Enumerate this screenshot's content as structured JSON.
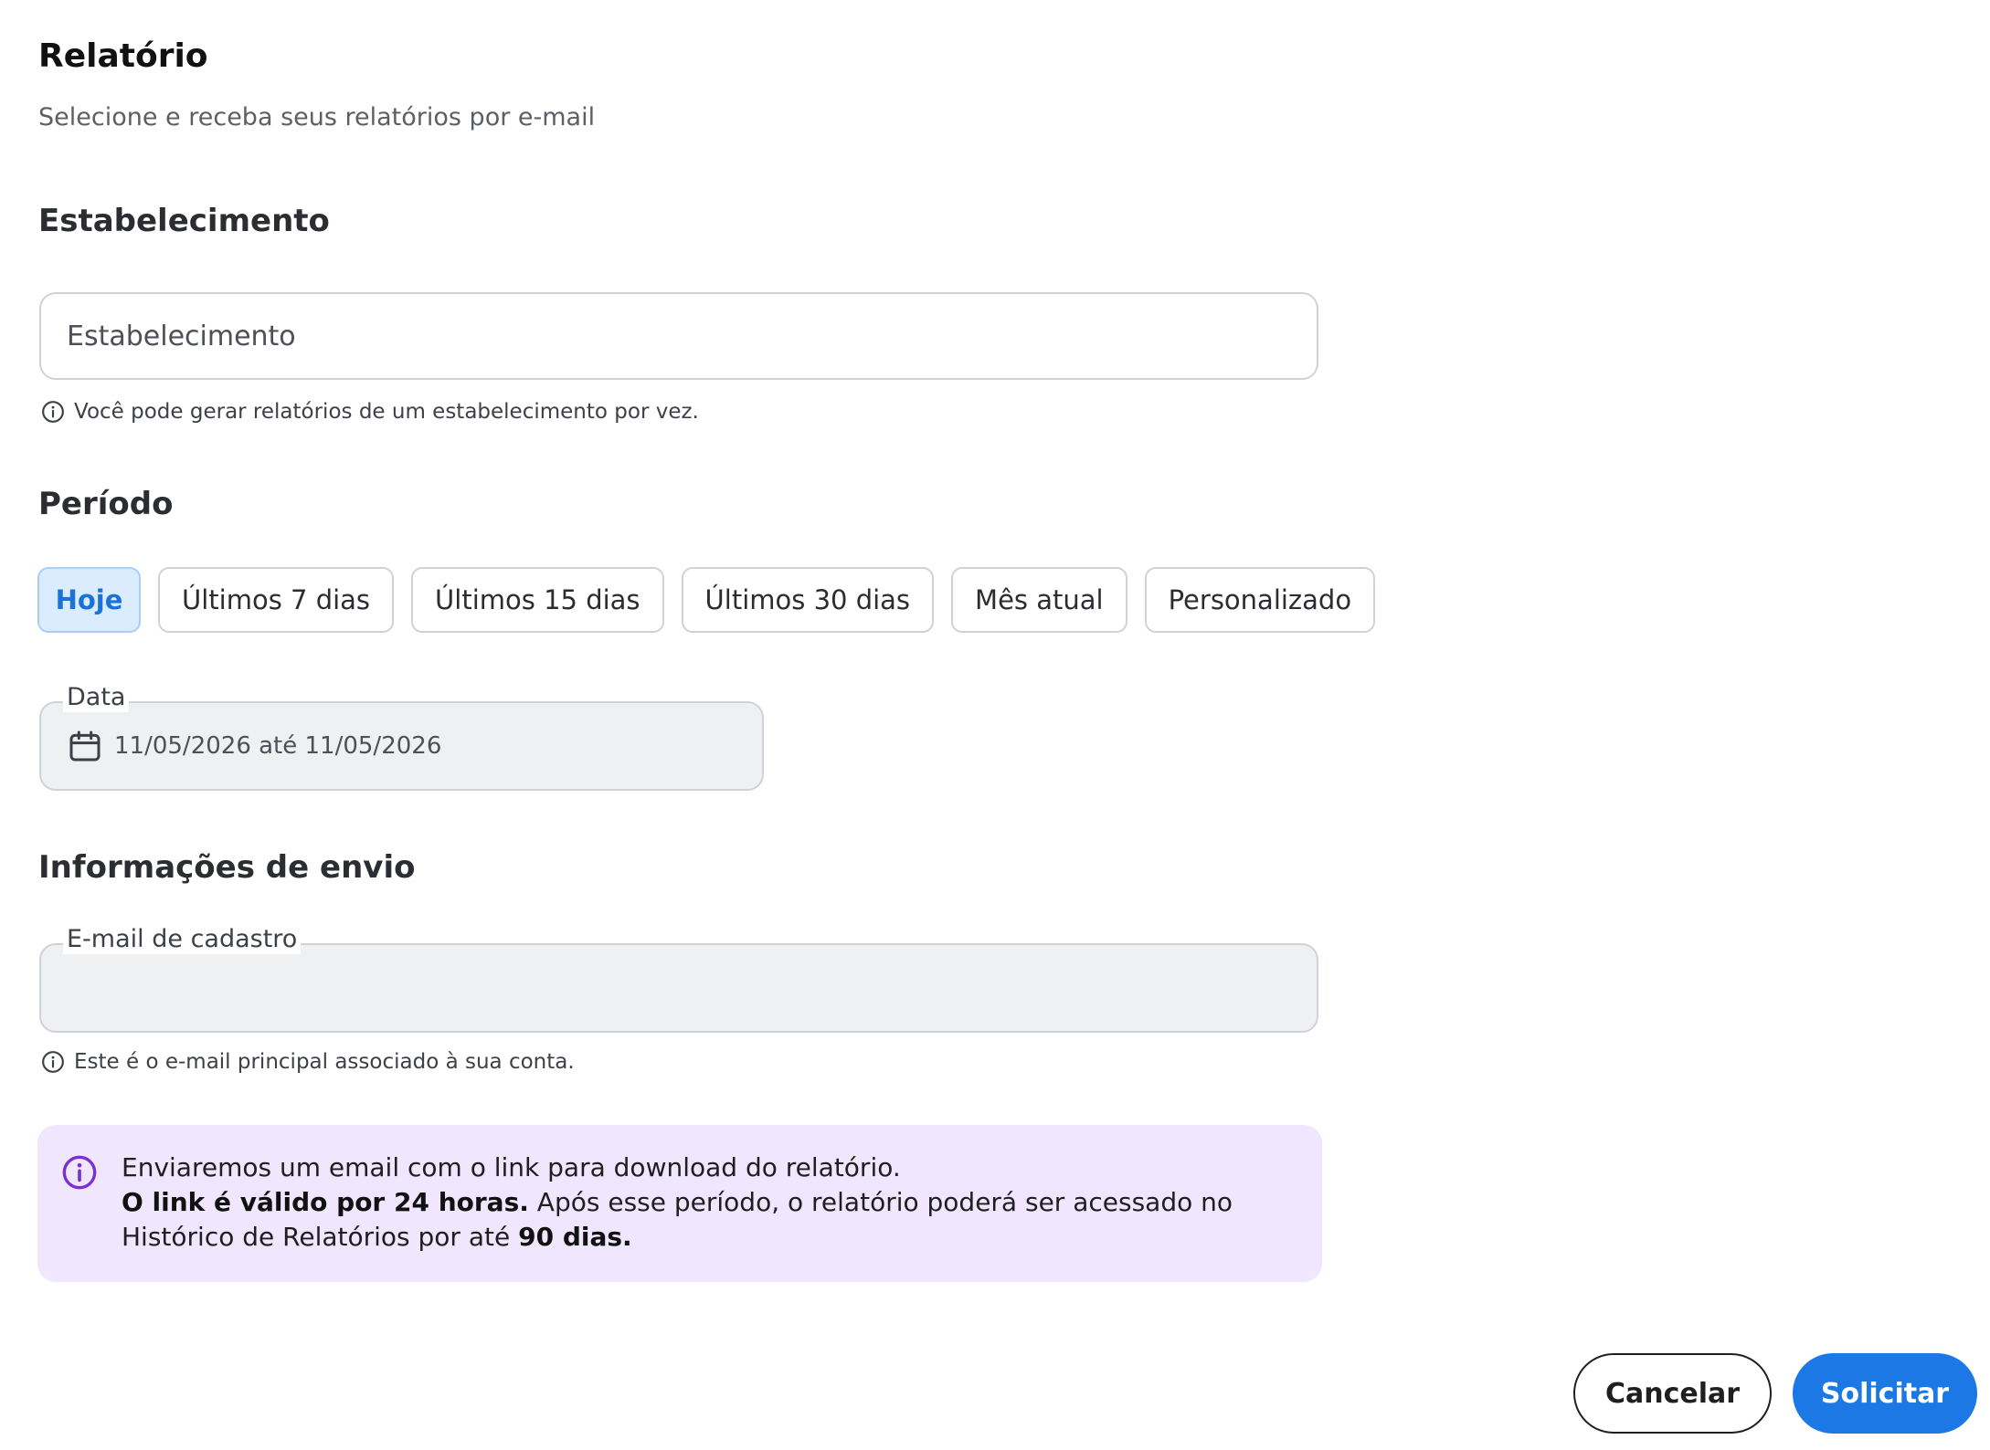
{
  "header": {
    "title": "Relatório",
    "subtitle": "Selecione e receba seus relatórios por e-mail"
  },
  "establishment": {
    "section_title": "Estabelecimento",
    "placeholder": "Estabelecimento",
    "hint": "Você pode gerar relatórios de um estabelecimento por vez."
  },
  "period": {
    "section_title": "Período",
    "options": [
      {
        "label": "Hoje",
        "selected": true
      },
      {
        "label": "Últimos 7 dias",
        "selected": false
      },
      {
        "label": "Últimos 15 dias",
        "selected": false
      },
      {
        "label": "Últimos 30 dias",
        "selected": false
      },
      {
        "label": "Mês atual",
        "selected": false
      },
      {
        "label": "Personalizado",
        "selected": false
      }
    ],
    "date_label": "Data",
    "date_value": "11/05/2026 até 11/05/2026"
  },
  "delivery": {
    "section_title": "Informações de envio",
    "email_label": "E-mail de cadastro",
    "email_value": "",
    "hint": "Este é o e-mail principal associado à sua conta."
  },
  "notice": {
    "line1": "Enviaremos um email com o link para download do relatório.",
    "bold1": "O link é válido por 24 horas.",
    "text2": " Após esse período, o relatório poderá ser acessado no Histórico de Relatórios por até ",
    "bold2": "90 dias."
  },
  "actions": {
    "cancel_label": "Cancelar",
    "submit_label": "Solicitar"
  },
  "colors": {
    "accent": "#1b78e4",
    "chip_active_bg": "#dcecff",
    "notice_bg": "#f0e6fd",
    "notice_icon": "#7b2fd6",
    "field_disabled_bg": "#eff0f2"
  },
  "icons": {
    "hint": "info-circle-icon",
    "date": "calendar-icon",
    "notice": "info-circle-icon"
  }
}
